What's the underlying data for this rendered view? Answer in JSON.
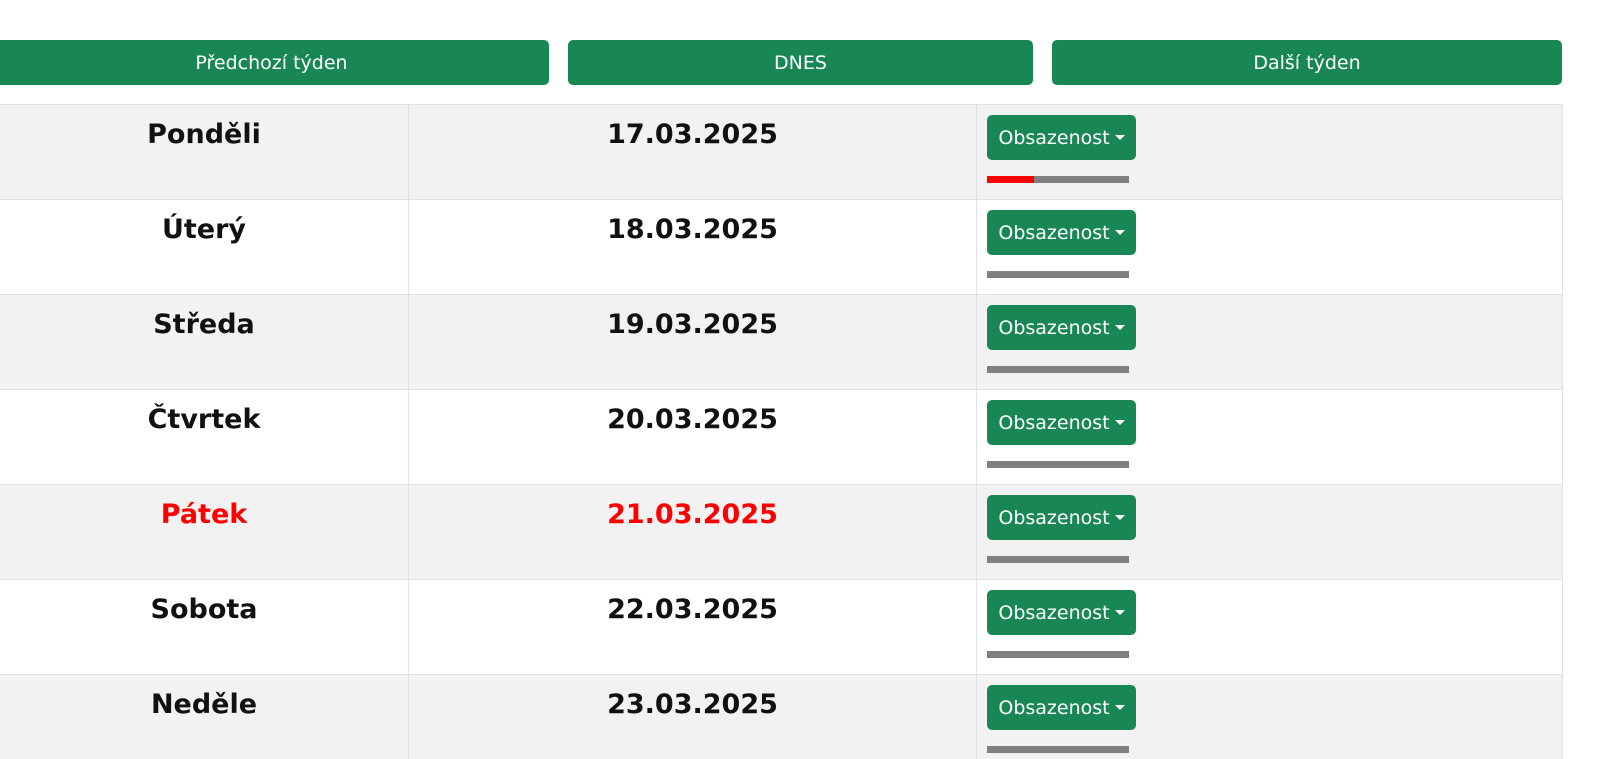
{
  "nav": {
    "prev_label": "Předchozí týden",
    "today_label": "DNES",
    "next_label": "Další týden"
  },
  "occupancy_label": "Obsazenost",
  "days": [
    {
      "day": "Ponděli",
      "date": "17.03.2025",
      "occupancy": 0.33,
      "today": false
    },
    {
      "day": "Úterý",
      "date": "18.03.2025",
      "occupancy": 0,
      "today": false
    },
    {
      "day": "Středa",
      "date": "19.03.2025",
      "occupancy": 0,
      "today": false
    },
    {
      "day": "Čtvrtek",
      "date": "20.03.2025",
      "occupancy": 0,
      "today": false
    },
    {
      "day": "Pátek",
      "date": "21.03.2025",
      "occupancy": 0,
      "today": true
    },
    {
      "day": "Sobota",
      "date": "22.03.2025",
      "occupancy": 0,
      "today": false
    },
    {
      "day": "Neděle",
      "date": "23.03.2025",
      "occupancy": 0,
      "today": false
    }
  ],
  "colors": {
    "primary": "#198754",
    "today": "#ff0000",
    "occupied": "#ff0000",
    "free": "#808080",
    "row_shade": "#f2f2f2"
  }
}
